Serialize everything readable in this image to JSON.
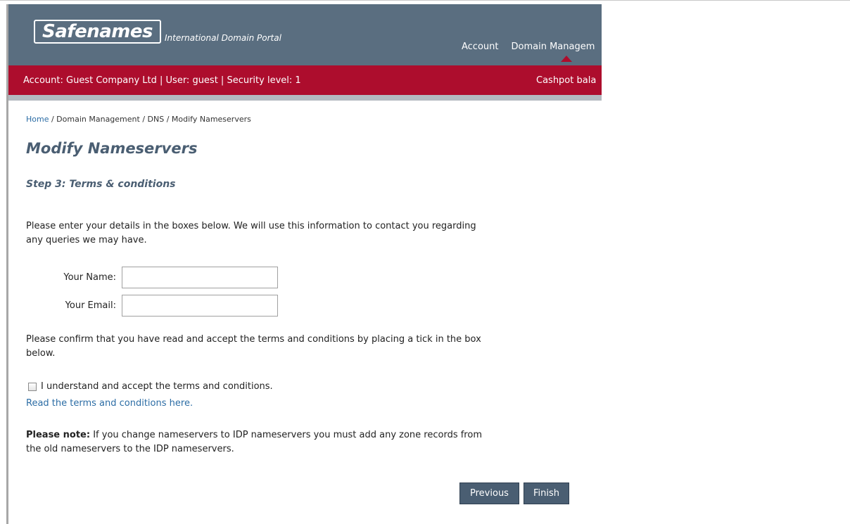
{
  "header": {
    "logo_text": "Safenames",
    "tagline": "International Domain Portal",
    "nav": [
      "Account",
      "Domain Managem"
    ]
  },
  "account_bar": {
    "info": "Account: Guest Company Ltd | User: guest | Security level: 1",
    "cashpot": "Cashpot bala"
  },
  "breadcrumb": {
    "home": "Home",
    "rest": " / Domain Management / DNS / Modify Nameservers"
  },
  "page": {
    "title": "Modify Nameservers",
    "step_title": "Step 3: Terms & conditions",
    "intro": "Please enter your details in the boxes below. We will use this information to contact you regarding any queries we may have.",
    "name_label": "Your Name:",
    "name_value": "",
    "email_label": "Your Email:",
    "email_value": "",
    "confirm_text": "Please confirm that you have read and accept the terms and conditions by placing a tick in the box below.",
    "checkbox_label": "I understand and accept the terms and conditions.",
    "terms_link": "Read the terms and conditions here.",
    "note_label": "Please note:",
    "note_text": " If you change nameservers to IDP nameservers you must add any zone records from the old nameservers to the IDP nameservers."
  },
  "buttons": {
    "previous": "Previous",
    "finish": "Finish"
  },
  "colors": {
    "header_bg": "#5a6e80",
    "account_bar_bg": "#ad0d2d",
    "title_color": "#4a5e72",
    "link_color": "#2c6da5",
    "button_bg": "#4a5e72"
  }
}
